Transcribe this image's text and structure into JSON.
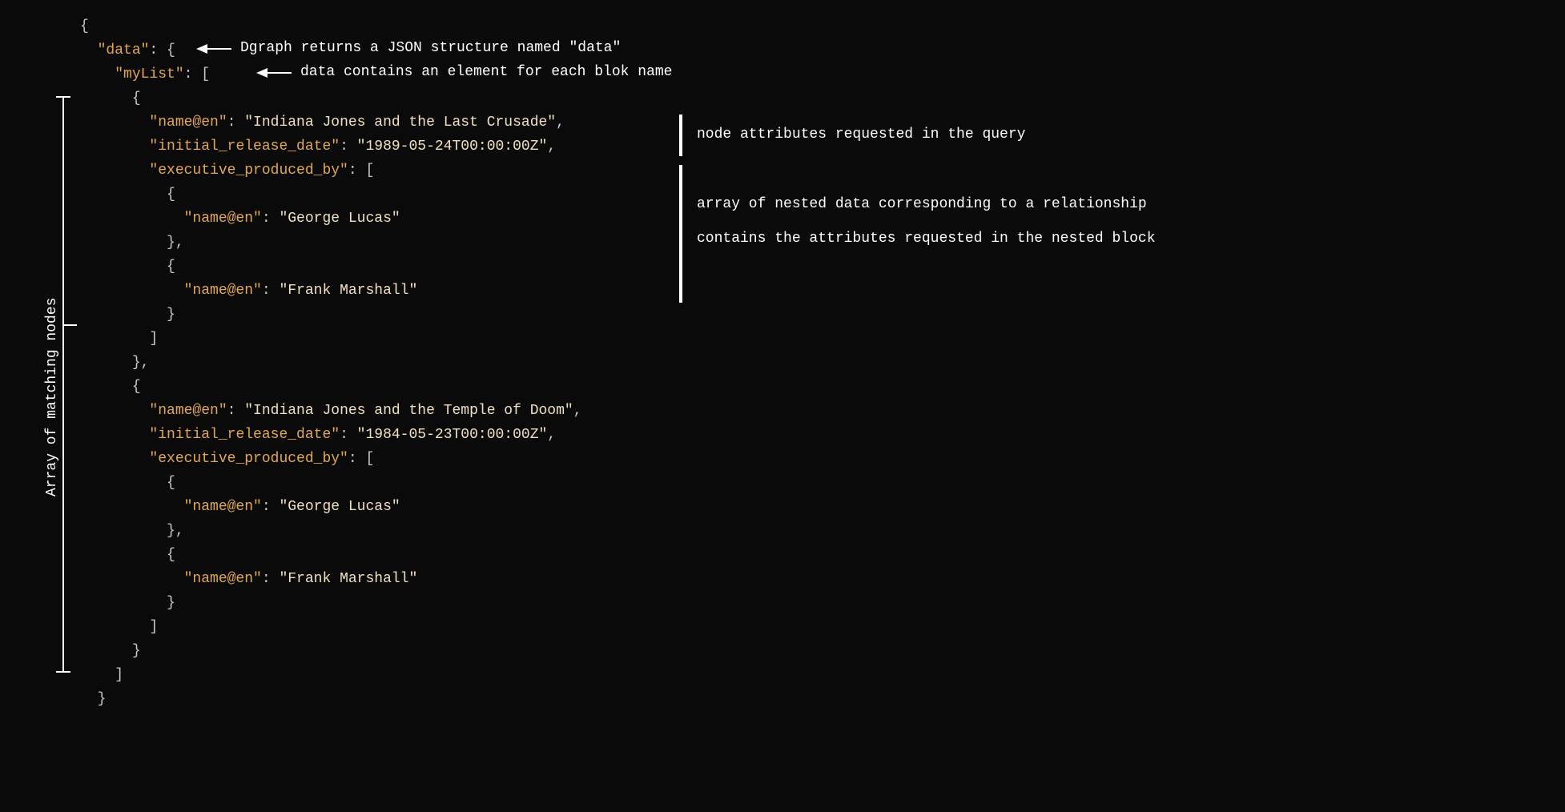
{
  "annotations": {
    "left_label": "Array of matching nodes",
    "data_note": "Dgraph returns a JSON structure named \"data\"",
    "mylist_note": "data contains an element for each blok name",
    "attrs_note": "node attributes requested in the query",
    "nested_note_1": "array of nested data corresponding to a relationship",
    "nested_note_2": "contains the attributes requested in the nested block"
  },
  "json": {
    "data_key": "\"data\"",
    "mylist_key": "\"myList\"",
    "name_key": "\"name@en\"",
    "release_key": "\"initial_release_date\"",
    "prod_key": "\"executive_produced_by\"",
    "movie1_name": "\"Indiana Jones and the Last Crusade\"",
    "movie1_date": "\"1989-05-24T00:00:00Z\"",
    "movie2_name": "\"Indiana Jones and the Temple of Doom\"",
    "movie2_date": "\"1984-05-23T00:00:00Z\"",
    "producer1": "\"George Lucas\"",
    "producer2": "\"Frank Marshall\""
  },
  "colors": {
    "bg": "#0a0a0a",
    "key": "#e5a84e",
    "value": "#f2e0c0",
    "punct": "#c8c8c8",
    "annotation": "#ffffff"
  }
}
